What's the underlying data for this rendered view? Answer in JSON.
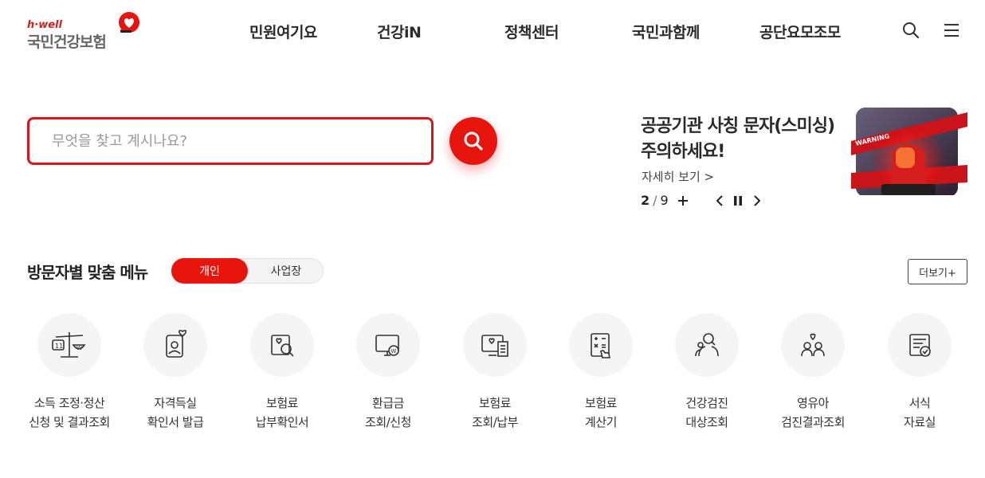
{
  "logo": {
    "sub": "h·well",
    "main": "국민건강보험"
  },
  "nav": [
    "민원여기요",
    "건강iN",
    "정책센터",
    "국민과함께",
    "공단요모조모"
  ],
  "header_icons": [
    "search-icon",
    "menu-icon"
  ],
  "search": {
    "placeholder": "무엇을 찾고 계시나요?"
  },
  "banner": {
    "title_line1": "공공기관 사칭 문자(스미싱)",
    "title_line2": "주의하세요!",
    "more": "자세히 보기 >",
    "current": "2",
    "total": "9",
    "image_text": "WARNING"
  },
  "visitor_menu": {
    "title": "방문자별 맞춤 메뉴",
    "toggle_active": "개인",
    "toggle_inactive": "사업장",
    "more_button": "더보기+",
    "items": [
      {
        "line1": "소득 조정·정산",
        "line2": "신청 및 결과조회",
        "icon": "scale-icon"
      },
      {
        "line1": "자격득실",
        "line2": "확인서 발급",
        "icon": "id-card-icon"
      },
      {
        "line1": "보험료",
        "line2": "납부확인서",
        "icon": "document-search-icon"
      },
      {
        "line1": "환급금",
        "line2": "조회/신청",
        "icon": "monitor-won-icon"
      },
      {
        "line1": "보험료",
        "line2": "조회/납부",
        "icon": "monitor-receipt-icon"
      },
      {
        "line1": "보험료",
        "line2": "계산기",
        "icon": "calculator-icon"
      },
      {
        "line1": "건강검진",
        "line2": "대상조회",
        "icon": "person-search-icon"
      },
      {
        "line1": "영유아",
        "line2": "검진결과조회",
        "icon": "children-icon"
      },
      {
        "line1": "서식",
        "line2": "자료실",
        "icon": "form-check-icon"
      }
    ]
  },
  "colors": {
    "accent": "#e8150f",
    "text": "#222222",
    "circle_bg": "#f5f5f5"
  }
}
